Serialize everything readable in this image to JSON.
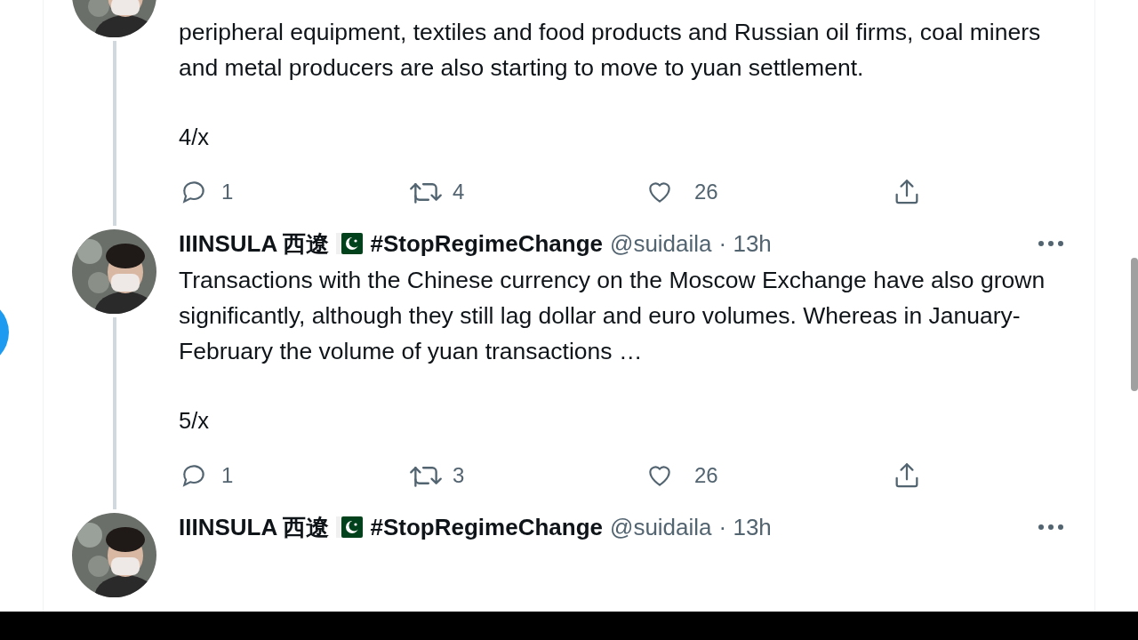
{
  "tweets": [
    {
      "body": "peripheral equipment, textiles and food products and Russian oil firms, coal miners and metal producers are also starting to move to yuan settlement.",
      "thread_mark": "4/x",
      "stats": {
        "replies": "1",
        "retweets": "4",
        "likes": "26"
      },
      "thread_continues": true
    },
    {
      "header": {
        "name": "IIINSULA 西遼",
        "hashtag": "#StopRegimeChange",
        "handle": "@suidaila",
        "time": "· 13h"
      },
      "body": "Transactions with the Chinese currency on the Moscow Exchange have also grown significantly, although they still lag dollar and euro volumes. Whereas in January-February the volume of yuan transactions …",
      "thread_mark": "5/x",
      "stats": {
        "replies": "1",
        "retweets": "3",
        "likes": "26"
      },
      "thread_continues": true
    },
    {
      "header": {
        "name": "IIINSULA 西遼",
        "hashtag": "#StopRegimeChange",
        "handle": "@suidaila",
        "time": "· 13h"
      },
      "thread_continues": false
    }
  ]
}
